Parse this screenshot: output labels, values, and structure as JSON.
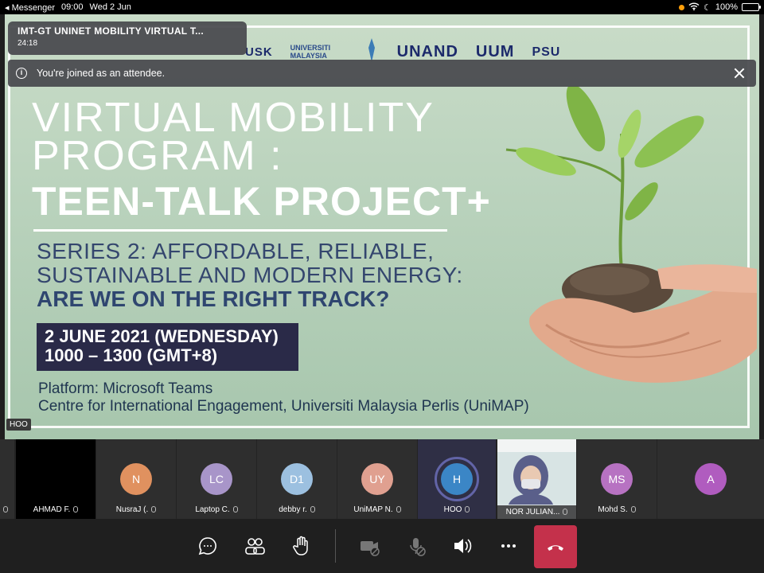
{
  "status_bar": {
    "back_app": "Messenger",
    "time": "09:00",
    "date": "Wed 2 Jun",
    "battery": "100%"
  },
  "meeting": {
    "title": "IMT-GT UNINET MOBILITY VIRTUAL T...",
    "duration": "24:18"
  },
  "notice": {
    "text": "You're joined as an attendee."
  },
  "slide": {
    "logos": [
      "USK",
      "UNIVERSITI MALAYSIA",
      "UNAND",
      "UUM",
      "PSU"
    ],
    "title_line1": "VIRTUAL MOBILITY",
    "title_line2": "PROGRAM :",
    "title_line3": "TEEN-TALK PROJECT+",
    "series_line1": "SERIES 2: AFFORDABLE, RELIABLE,",
    "series_line2": "SUSTAINABLE AND MODERN ENERGY:",
    "series_line3": "ARE WE ON THE RIGHT TRACK?",
    "date_line1": "2 JUNE 2021 (WEDNESDAY)",
    "date_line2": "1000 – 1300 (GMT+8)",
    "platform_line1": "Platform: Microsoft Teams",
    "platform_line2": "Centre for International Engagement, Universiti Malaysia Perlis (UniMAP)"
  },
  "presenter_tag": "HOO",
  "participants": [
    {
      "initials": "",
      "name": "AHMAD F.",
      "color": "#000000",
      "type": "video-off"
    },
    {
      "initials": "N",
      "name": "NusraJ (.",
      "color": "#e0915f",
      "type": "avatar"
    },
    {
      "initials": "LC",
      "name": "Laptop C.",
      "color": "#a895c9",
      "type": "avatar"
    },
    {
      "initials": "D1",
      "name": "debby r.",
      "color": "#9cc0e0",
      "type": "avatar"
    },
    {
      "initials": "UY",
      "name": "UniMAP N.",
      "color": "#e0a090",
      "type": "avatar"
    },
    {
      "initials": "H",
      "name": "HOO",
      "color": "#3b86c6",
      "type": "selected"
    },
    {
      "initials": "",
      "name": "NOR JULIAN...",
      "color": "#dfe7ea",
      "type": "video"
    },
    {
      "initials": "MS",
      "name": "Mohd S.",
      "color": "#b772c2",
      "type": "avatar"
    },
    {
      "initials": "A",
      "name": "",
      "color": "#b05cbf",
      "type": "avatar"
    }
  ],
  "controls": [
    "chat",
    "participants",
    "raise-hand",
    "camera-off",
    "mic-off",
    "speaker",
    "more",
    "hang-up"
  ]
}
